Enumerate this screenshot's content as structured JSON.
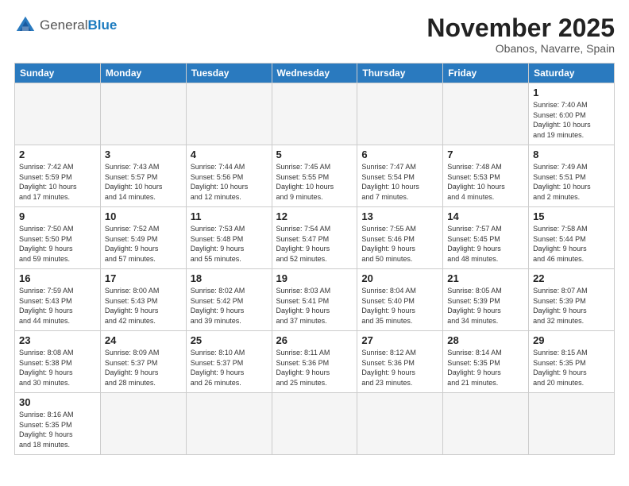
{
  "header": {
    "logo": {
      "general": "General",
      "blue": "Blue"
    },
    "title": "November 2025",
    "subtitle": "Obanos, Navarre, Spain"
  },
  "weekdays": [
    "Sunday",
    "Monday",
    "Tuesday",
    "Wednesday",
    "Thursday",
    "Friday",
    "Saturday"
  ],
  "weeks": [
    [
      {
        "day": "",
        "info": "",
        "empty": true
      },
      {
        "day": "",
        "info": "",
        "empty": true
      },
      {
        "day": "",
        "info": "",
        "empty": true
      },
      {
        "day": "",
        "info": "",
        "empty": true
      },
      {
        "day": "",
        "info": "",
        "empty": true
      },
      {
        "day": "",
        "info": "",
        "empty": true
      },
      {
        "day": "1",
        "info": "Sunrise: 7:40 AM\nSunset: 6:00 PM\nDaylight: 10 hours\nand 19 minutes."
      }
    ],
    [
      {
        "day": "2",
        "info": "Sunrise: 7:42 AM\nSunset: 5:59 PM\nDaylight: 10 hours\nand 17 minutes."
      },
      {
        "day": "3",
        "info": "Sunrise: 7:43 AM\nSunset: 5:57 PM\nDaylight: 10 hours\nand 14 minutes."
      },
      {
        "day": "4",
        "info": "Sunrise: 7:44 AM\nSunset: 5:56 PM\nDaylight: 10 hours\nand 12 minutes."
      },
      {
        "day": "5",
        "info": "Sunrise: 7:45 AM\nSunset: 5:55 PM\nDaylight: 10 hours\nand 9 minutes."
      },
      {
        "day": "6",
        "info": "Sunrise: 7:47 AM\nSunset: 5:54 PM\nDaylight: 10 hours\nand 7 minutes."
      },
      {
        "day": "7",
        "info": "Sunrise: 7:48 AM\nSunset: 5:53 PM\nDaylight: 10 hours\nand 4 minutes."
      },
      {
        "day": "8",
        "info": "Sunrise: 7:49 AM\nSunset: 5:51 PM\nDaylight: 10 hours\nand 2 minutes."
      }
    ],
    [
      {
        "day": "9",
        "info": "Sunrise: 7:50 AM\nSunset: 5:50 PM\nDaylight: 9 hours\nand 59 minutes."
      },
      {
        "day": "10",
        "info": "Sunrise: 7:52 AM\nSunset: 5:49 PM\nDaylight: 9 hours\nand 57 minutes."
      },
      {
        "day": "11",
        "info": "Sunrise: 7:53 AM\nSunset: 5:48 PM\nDaylight: 9 hours\nand 55 minutes."
      },
      {
        "day": "12",
        "info": "Sunrise: 7:54 AM\nSunset: 5:47 PM\nDaylight: 9 hours\nand 52 minutes."
      },
      {
        "day": "13",
        "info": "Sunrise: 7:55 AM\nSunset: 5:46 PM\nDaylight: 9 hours\nand 50 minutes."
      },
      {
        "day": "14",
        "info": "Sunrise: 7:57 AM\nSunset: 5:45 PM\nDaylight: 9 hours\nand 48 minutes."
      },
      {
        "day": "15",
        "info": "Sunrise: 7:58 AM\nSunset: 5:44 PM\nDaylight: 9 hours\nand 46 minutes."
      }
    ],
    [
      {
        "day": "16",
        "info": "Sunrise: 7:59 AM\nSunset: 5:43 PM\nDaylight: 9 hours\nand 44 minutes."
      },
      {
        "day": "17",
        "info": "Sunrise: 8:00 AM\nSunset: 5:43 PM\nDaylight: 9 hours\nand 42 minutes."
      },
      {
        "day": "18",
        "info": "Sunrise: 8:02 AM\nSunset: 5:42 PM\nDaylight: 9 hours\nand 39 minutes."
      },
      {
        "day": "19",
        "info": "Sunrise: 8:03 AM\nSunset: 5:41 PM\nDaylight: 9 hours\nand 37 minutes."
      },
      {
        "day": "20",
        "info": "Sunrise: 8:04 AM\nSunset: 5:40 PM\nDaylight: 9 hours\nand 35 minutes."
      },
      {
        "day": "21",
        "info": "Sunrise: 8:05 AM\nSunset: 5:39 PM\nDaylight: 9 hours\nand 34 minutes."
      },
      {
        "day": "22",
        "info": "Sunrise: 8:07 AM\nSunset: 5:39 PM\nDaylight: 9 hours\nand 32 minutes."
      }
    ],
    [
      {
        "day": "23",
        "info": "Sunrise: 8:08 AM\nSunset: 5:38 PM\nDaylight: 9 hours\nand 30 minutes."
      },
      {
        "day": "24",
        "info": "Sunrise: 8:09 AM\nSunset: 5:37 PM\nDaylight: 9 hours\nand 28 minutes."
      },
      {
        "day": "25",
        "info": "Sunrise: 8:10 AM\nSunset: 5:37 PM\nDaylight: 9 hours\nand 26 minutes."
      },
      {
        "day": "26",
        "info": "Sunrise: 8:11 AM\nSunset: 5:36 PM\nDaylight: 9 hours\nand 25 minutes."
      },
      {
        "day": "27",
        "info": "Sunrise: 8:12 AM\nSunset: 5:36 PM\nDaylight: 9 hours\nand 23 minutes."
      },
      {
        "day": "28",
        "info": "Sunrise: 8:14 AM\nSunset: 5:35 PM\nDaylight: 9 hours\nand 21 minutes."
      },
      {
        "day": "29",
        "info": "Sunrise: 8:15 AM\nSunset: 5:35 PM\nDaylight: 9 hours\nand 20 minutes."
      }
    ],
    [
      {
        "day": "30",
        "info": "Sunrise: 8:16 AM\nSunset: 5:35 PM\nDaylight: 9 hours\nand 18 minutes."
      },
      {
        "day": "",
        "info": "",
        "empty": true
      },
      {
        "day": "",
        "info": "",
        "empty": true
      },
      {
        "day": "",
        "info": "",
        "empty": true
      },
      {
        "day": "",
        "info": "",
        "empty": true
      },
      {
        "day": "",
        "info": "",
        "empty": true
      },
      {
        "day": "",
        "info": "",
        "empty": true
      }
    ]
  ]
}
